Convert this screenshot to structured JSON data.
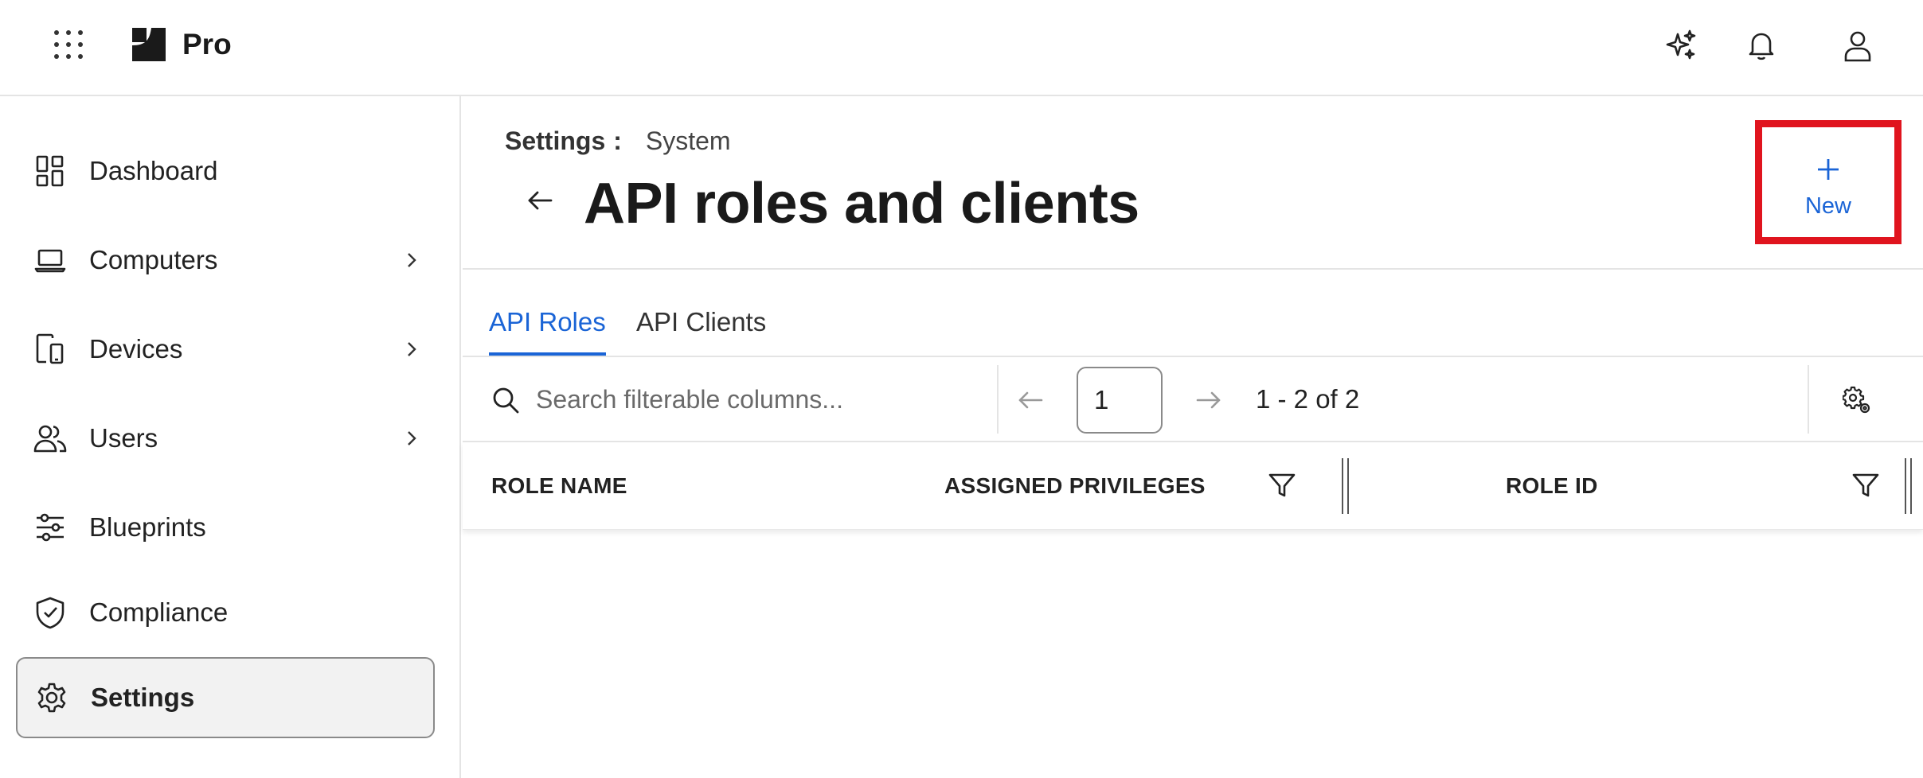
{
  "header": {
    "product_name": "Pro",
    "icons": [
      "apps-grid-icon",
      "logo-icon",
      "sparkles-icon",
      "bell-icon",
      "user-icon"
    ]
  },
  "sidebar": {
    "items": [
      {
        "label": "Dashboard",
        "icon": "dashboard-icon",
        "has_chevron": false
      },
      {
        "label": "Computers",
        "icon": "laptop-icon",
        "has_chevron": true
      },
      {
        "label": "Devices",
        "icon": "devices-icon",
        "has_chevron": true
      },
      {
        "label": "Users",
        "icon": "users-icon",
        "has_chevron": true
      },
      {
        "label": "Blueprints",
        "icon": "sliders-icon",
        "has_chevron": false
      },
      {
        "label": "Compliance",
        "icon": "shield-check-icon",
        "has_chevron": false
      },
      {
        "label": "Settings",
        "icon": "gear-icon",
        "has_chevron": false,
        "active": true
      }
    ]
  },
  "page": {
    "breadcrumb_root": "Settings",
    "breadcrumb_sep": ":",
    "breadcrumb_current": "System",
    "title": "API roles and clients",
    "new_button_label": "New"
  },
  "tabs": [
    {
      "label": "API Roles",
      "active": true
    },
    {
      "label": "API Clients",
      "active": false
    }
  ],
  "toolbar": {
    "search_placeholder": "Search filterable columns...",
    "page_number": "1",
    "page_range": "1 - 2 of 2"
  },
  "table": {
    "columns": [
      {
        "label": "ROLE NAME",
        "filterable": true
      },
      {
        "label": "ASSIGNED PRIVILEGES",
        "filterable": false
      },
      {
        "label": "ROLE ID",
        "filterable": true
      }
    ]
  },
  "colors": {
    "accent": "#1a64d6",
    "highlight_box": "#e0141e",
    "border": "#e4e4e4"
  }
}
